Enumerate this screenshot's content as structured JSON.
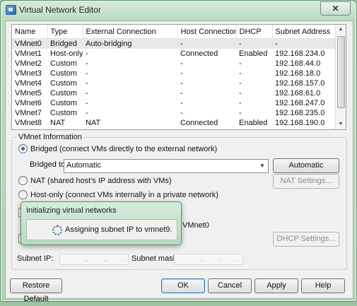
{
  "window": {
    "title": "Virtual Network Editor",
    "close_glyph": "✕"
  },
  "netlist": {
    "columns": [
      "Name",
      "Type",
      "External Connection",
      "Host Connection",
      "DHCP",
      "Subnet Address"
    ],
    "rows": [
      [
        "VMnet0",
        "Bridged",
        "Auto-bridging",
        "-",
        "-",
        "-"
      ],
      [
        "VMnet1",
        "Host-only",
        "-",
        "Connected",
        "Enabled",
        "192.168.234.0"
      ],
      [
        "VMnet2",
        "Custom",
        "-",
        "-",
        "-",
        "192.168.44.0"
      ],
      [
        "VMnet3",
        "Custom",
        "-",
        "-",
        "-",
        "192.168.18.0"
      ],
      [
        "VMnet4",
        "Custom",
        "-",
        "-",
        "-",
        "192.168.157.0"
      ],
      [
        "VMnet5",
        "Custom",
        "-",
        "-",
        "-",
        "192.168.61.0"
      ],
      [
        "VMnet6",
        "Custom",
        "-",
        "-",
        "-",
        "192.168.247.0"
      ],
      [
        "VMnet7",
        "Custom",
        "-",
        "-",
        "-",
        "192.168.235.0"
      ],
      [
        "VMnet8",
        "NAT",
        "NAT",
        "Connected",
        "Enabled",
        "192.168.190.0"
      ]
    ]
  },
  "vmnet_info": {
    "group_label": "VMnet Information",
    "bridged_label": "Bridged (connect VMs directly to the external network)",
    "bridged_to_label": "Bridged to:",
    "bridged_to_value": "Automatic",
    "automatic_settings": "Automatic Settings...",
    "nat_label": "NAT (shared host's IP address with VMs)",
    "nat_settings": "NAT Settings...",
    "hostonly_label": "Host-only (connect VMs internally in a private network)",
    "adapter_partial": "VMnet0",
    "dhcp_settings": "DHCP Settings...",
    "subnet_ip_label": "Subnet IP:",
    "subnet_mask_label": "Subnet mask:",
    "ip_dots": "...",
    "mask_dots": "..."
  },
  "popup": {
    "title": "Initializing virtual networks",
    "message": "Assigning subnet IP to vmnet9."
  },
  "buttons": {
    "restore_default": "Restore Default",
    "ok": "OK",
    "cancel": "Cancel",
    "apply": "Apply",
    "help": "Help"
  }
}
